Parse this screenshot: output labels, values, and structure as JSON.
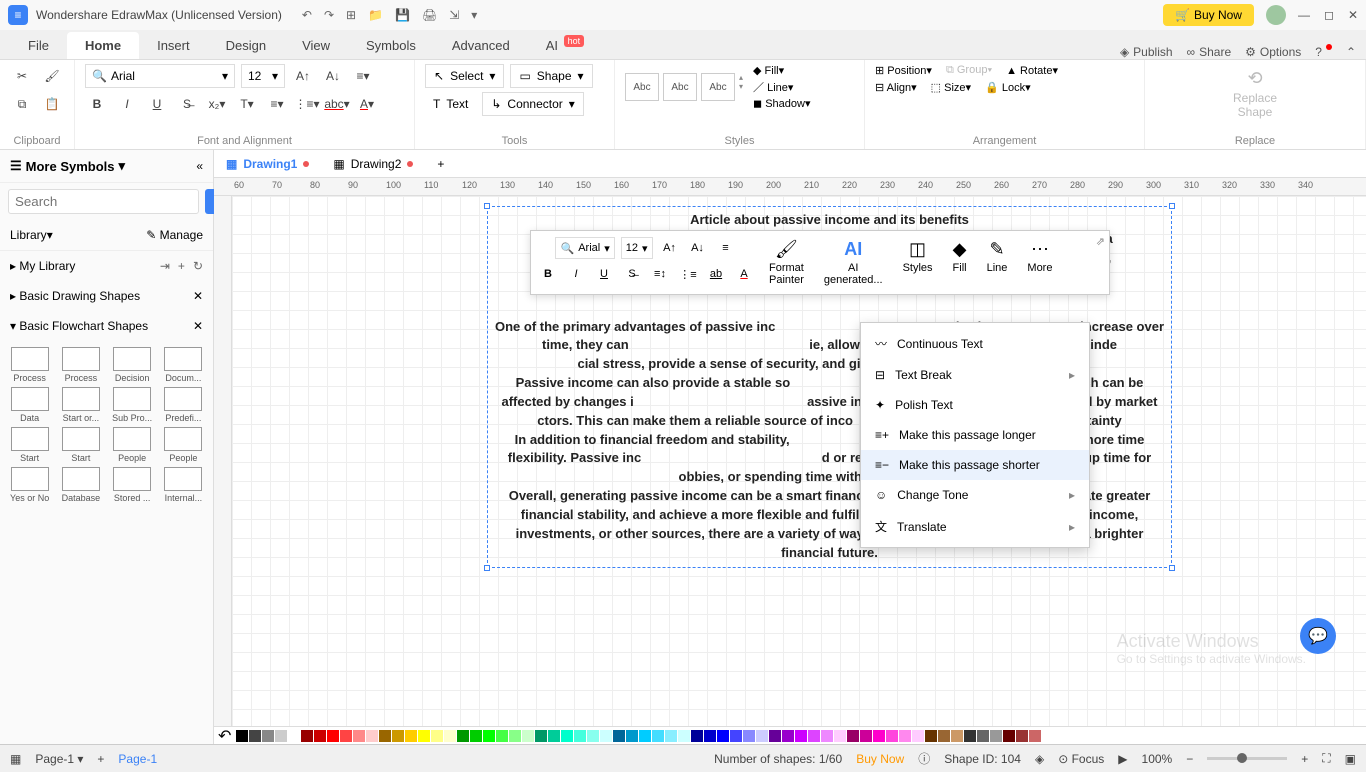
{
  "titlebar": {
    "app_name": "Wondershare EdrawMax (Unlicensed Version)",
    "buy_now": "Buy Now"
  },
  "menutabs": {
    "file": "File",
    "home": "Home",
    "insert": "Insert",
    "design": "Design",
    "view": "View",
    "symbols": "Symbols",
    "advanced": "Advanced",
    "ai": "AI",
    "ai_badge": "hot",
    "publish": "Publish",
    "share": "Share",
    "options": "Options"
  },
  "ribbon": {
    "clipboard_label": "Clipboard",
    "font_label": "Font and Alignment",
    "tools_label": "Tools",
    "styles_label": "Styles",
    "arrangement_label": "Arrangement",
    "replace_label": "Replace",
    "font_name": "Arial",
    "font_size": "12",
    "select": "Select",
    "shape": "Shape",
    "text": "Text",
    "connector": "Connector",
    "style_abc": "Abc",
    "fill": "Fill",
    "line": "Line",
    "shadow": "Shadow",
    "position": "Position",
    "align": "Align",
    "group": "Group",
    "size": "Size",
    "rotate": "Rotate",
    "lock": "Lock",
    "replace_shape": "Replace\nShape"
  },
  "left_panel": {
    "more_symbols": "More Symbols",
    "search_placeholder": "Search",
    "search_btn": "Search",
    "library": "Library",
    "manage": "Manage",
    "my_library": "My Library",
    "basic_drawing": "Basic Drawing Shapes",
    "basic_flowchart": "Basic Flowchart Shapes",
    "shapes": [
      {
        "label": "Process"
      },
      {
        "label": "Process"
      },
      {
        "label": "Decision"
      },
      {
        "label": "Docum..."
      },
      {
        "label": "Data"
      },
      {
        "label": "Start or..."
      },
      {
        "label": "Sub Pro..."
      },
      {
        "label": "Predefi..."
      },
      {
        "label": "Start"
      },
      {
        "label": "Start"
      },
      {
        "label": "People"
      },
      {
        "label": "People"
      },
      {
        "label": "Yes or No"
      },
      {
        "label": "Database"
      },
      {
        "label": "Stored ..."
      },
      {
        "label": "Internal..."
      }
    ]
  },
  "doc_tabs": {
    "drawing1": "Drawing1",
    "drawing2": "Drawing2"
  },
  "ruler_marks": [
    "60",
    "70",
    "80",
    "90",
    "100",
    "110",
    "120",
    "130",
    "140",
    "150",
    "160",
    "170",
    "180",
    "190",
    "200",
    "210",
    "220",
    "230",
    "240",
    "250",
    "260",
    "270",
    "280",
    "290",
    "300",
    "310",
    "320",
    "330",
    "340"
  ],
  "article": {
    "title": "Article about passive income and its benefits",
    "p1": "Pass                                                                                                                                  ain. It is ea                                                                                                                                    s, or inv                                                                                                                                         ne,",
    "p2": "One of the primary advantages of passive inc                                                  ive income streams increase over time, they can                                                  ie, allowing individuals to become financially inde                                                 cial stress, provide a sense of security, and give p                                                 es.",
    "p3": "Passive income can also provide a stable so                                                  l employment, which can be affected by changes i                                                assive income streams are often not impacted by market                                                 ctors. This can make them a reliable source of inco                                                   ic uncertainty",
    "p4": "In addition to financial freedom and stability,                                                  e individuals with more time flexibility. Passive inc                                                  d or require minimal maintenance, freeing up time for                                                obbies, or spending time with family and friends.",
    "p5": "Overall, generating passive income can be a smart financial strategy to help build wealth, create greater financial stability, and achieve a more flexible and fulfilling lifestyle. Whether through rental income, investments, or other sources, there are a variety of ways to earn passive income and build a brighter financial future."
  },
  "float_toolbar": {
    "font": "Arial",
    "size": "12",
    "format_painter": "Format\nPainter",
    "ai_gen": "AI\ngenerated...",
    "styles": "Styles",
    "fill": "Fill",
    "line": "Line",
    "more": "More"
  },
  "context_menu": {
    "continuous": "Continuous Text",
    "text_break": "Text Break",
    "polish": "Polish Text",
    "longer": "Make this passage longer",
    "shorter": "Make this passage shorter",
    "change_tone": "Change Tone",
    "translate": "Translate"
  },
  "statusbar": {
    "page": "Page-1",
    "page_link": "Page-1",
    "shapes": "Number of shapes: 1/60",
    "buy_now": "Buy Now",
    "shape_id": "Shape ID: 104",
    "focus": "Focus",
    "zoom": "100%"
  },
  "watermark": {
    "line1": "Activate Windows",
    "line2": "Go to Settings to activate Windows."
  },
  "colors": [
    "#000",
    "#444",
    "#888",
    "#ccc",
    "#fff",
    "#900",
    "#c00",
    "#f00",
    "#f44",
    "#f88",
    "#fcc",
    "#960",
    "#c90",
    "#fc0",
    "#ff0",
    "#ff8",
    "#ffc",
    "#090",
    "#0c0",
    "#0f0",
    "#4f4",
    "#8f8",
    "#cfc",
    "#096",
    "#0c9",
    "#0fc",
    "#4fd",
    "#8fe",
    "#cff",
    "#069",
    "#09c",
    "#0cf",
    "#4df",
    "#8ef",
    "#cff",
    "#009",
    "#00c",
    "#00f",
    "#44f",
    "#88f",
    "#ccf",
    "#609",
    "#90c",
    "#c0f",
    "#d4f",
    "#e8f",
    "#fcf",
    "#906",
    "#c09",
    "#f0c",
    "#f4d",
    "#f8e",
    "#fcf",
    "#630",
    "#963",
    "#c96",
    "#333",
    "#666",
    "#999",
    "#600",
    "#933",
    "#c66"
  ]
}
